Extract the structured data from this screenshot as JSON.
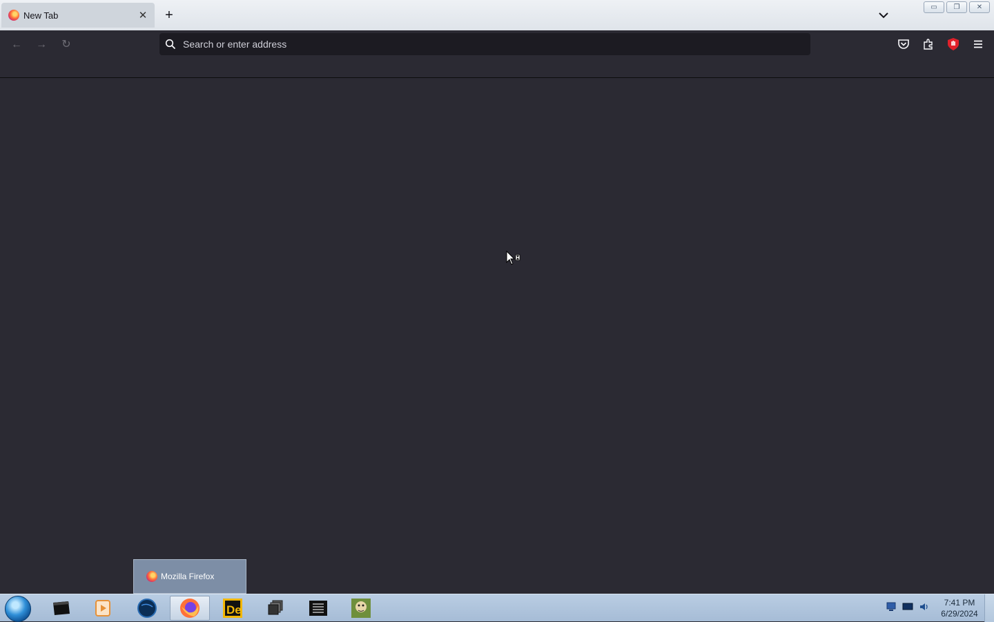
{
  "browser": {
    "tab": {
      "title": "New Tab",
      "close_glyph": "✕"
    },
    "newtab_glyph": "+",
    "urlbar": {
      "placeholder": "Search or enter address",
      "value": ""
    },
    "nav": {
      "back_glyph": "←",
      "forward_glyph": "→",
      "reload_glyph": "↻"
    },
    "toolbar_icons": [
      "pocket-icon",
      "extensions-icon",
      "ublock-icon",
      "menu-icon"
    ]
  },
  "window_controls": {
    "minimize": "▭",
    "restore": "❐",
    "close": "✕"
  },
  "taskbar": {
    "preview": {
      "label": "Mozilla Firefox"
    },
    "apps": [
      "terminal-app",
      "media-player-app",
      "globe-app",
      "firefox-app",
      "de-app",
      "windows-app",
      "notepad-app",
      "game-app"
    ],
    "clock": {
      "time": "7:41 PM",
      "date": "6/29/2024"
    }
  },
  "colors": {
    "content_bg": "#2b2a33",
    "urlbar_bg": "#1c1b22",
    "taskbar_bg": "#b2c6dc"
  }
}
